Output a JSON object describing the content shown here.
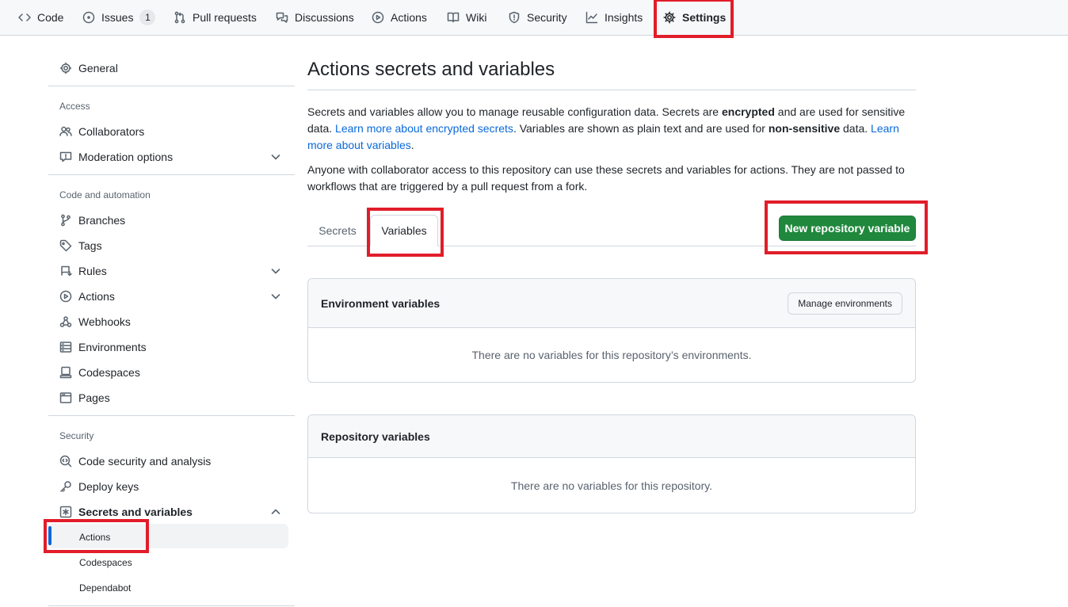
{
  "nav": {
    "items": [
      {
        "label": "Code",
        "icon": "code-icon"
      },
      {
        "label": "Issues",
        "icon": "issue-opened-icon",
        "count": "1"
      },
      {
        "label": "Pull requests",
        "icon": "git-pull-request-icon"
      },
      {
        "label": "Discussions",
        "icon": "comment-discussion-icon"
      },
      {
        "label": "Actions",
        "icon": "play-icon"
      },
      {
        "label": "Wiki",
        "icon": "book-icon"
      },
      {
        "label": "Security",
        "icon": "shield-icon"
      },
      {
        "label": "Insights",
        "icon": "graph-icon"
      },
      {
        "label": "Settings",
        "icon": "gear-icon",
        "active": true
      }
    ]
  },
  "sidebar": {
    "general": "General",
    "access_heading": "Access",
    "access": [
      {
        "label": "Collaborators",
        "icon": "people-icon"
      },
      {
        "label": "Moderation options",
        "icon": "report-icon",
        "expandable": true
      }
    ],
    "code_heading": "Code and automation",
    "code": [
      {
        "label": "Branches",
        "icon": "git-branch-icon"
      },
      {
        "label": "Tags",
        "icon": "tag-icon"
      },
      {
        "label": "Rules",
        "icon": "repo-push-icon",
        "expandable": true
      },
      {
        "label": "Actions",
        "icon": "play-icon",
        "expandable": true
      },
      {
        "label": "Webhooks",
        "icon": "webhook-icon"
      },
      {
        "label": "Environments",
        "icon": "server-icon"
      },
      {
        "label": "Codespaces",
        "icon": "codespaces-icon"
      },
      {
        "label": "Pages",
        "icon": "browser-icon"
      }
    ],
    "security_heading": "Security",
    "security": [
      {
        "label": "Code security and analysis",
        "icon": "codescan-icon"
      },
      {
        "label": "Deploy keys",
        "icon": "key-icon"
      },
      {
        "label": "Secrets and variables",
        "icon": "key-asterisk-icon",
        "expanded": true
      }
    ],
    "secrets_sub": [
      "Actions",
      "Codespaces",
      "Dependabot"
    ],
    "active_sub": "Actions"
  },
  "main": {
    "title": "Actions secrets and variables",
    "intro": {
      "p1_a": "Secrets and variables allow you to manage reusable configuration data. Secrets are ",
      "p1_b": "encrypted",
      "p1_c": " and are used for sensitive data. ",
      "p1_link1": "Learn more about encrypted secrets",
      "p1_d": ". Variables are shown as plain text and are used for ",
      "p1_e": "non-sensitive",
      "p1_f": " data. ",
      "p1_link2": "Learn more about variables",
      "p1_g": ".",
      "p2": "Anyone with collaborator access to this repository can use these secrets and variables for actions. They are not passed to workflows that are triggered by a pull request from a fork."
    },
    "tabs": [
      "Secrets",
      "Variables"
    ],
    "active_tab": "Variables",
    "new_button": "New repository variable",
    "env_box": {
      "title": "Environment variables",
      "button": "Manage environments",
      "empty": "There are no variables for this repository’s environments."
    },
    "repo_box": {
      "title": "Repository variables",
      "empty": "There are no variables for this repository."
    }
  },
  "colors": {
    "accent": "#0969da",
    "primary_button": "#1f883d",
    "highlight": "#e11d2a"
  }
}
